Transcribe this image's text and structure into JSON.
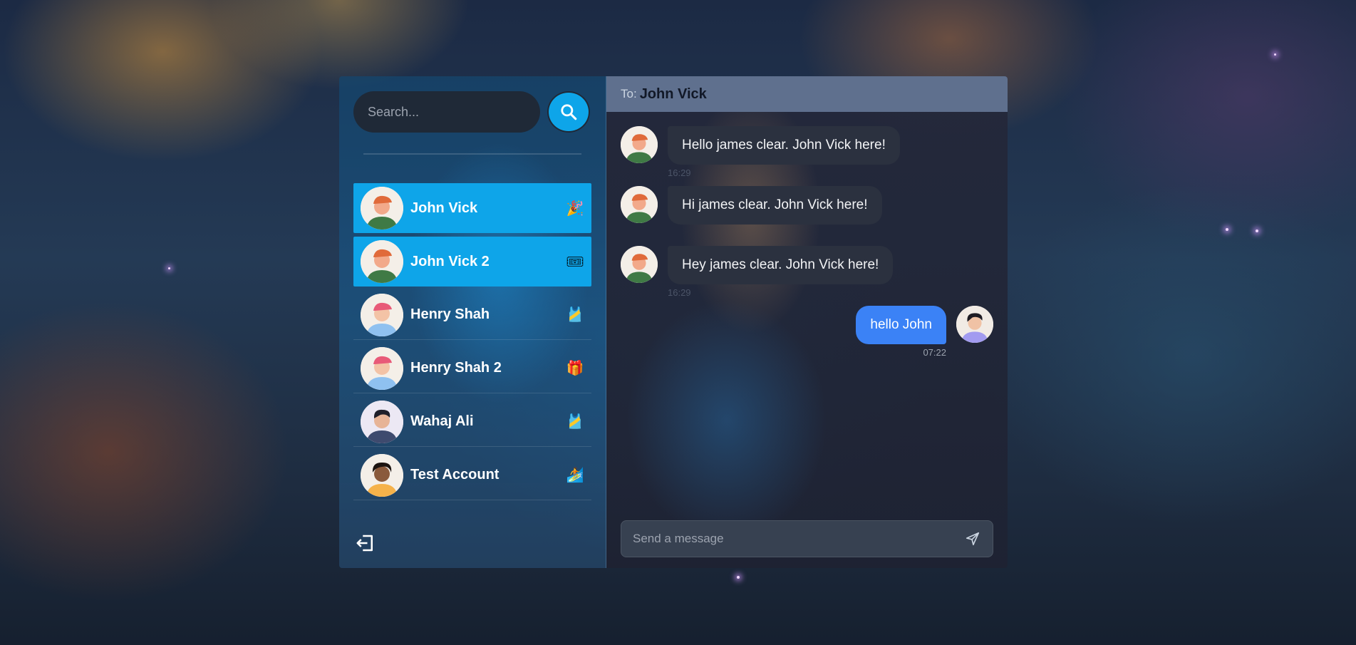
{
  "search": {
    "placeholder": "Search..."
  },
  "contacts": [
    {
      "name": "John Vick",
      "status_icon": "party-popper-icon",
      "status_glyph": "🎉",
      "active": true
    },
    {
      "name": "John Vick 2",
      "status_icon": "ticket-icon",
      "status_glyph": "🎟",
      "active": true
    },
    {
      "name": "Henry Shah",
      "status_icon": "sash-icon",
      "status_glyph": "🎽",
      "active": false
    },
    {
      "name": "Henry Shah 2",
      "status_icon": "gift-icon",
      "status_glyph": "🎁",
      "active": false
    },
    {
      "name": "Wahaj Ali",
      "status_icon": "sash-icon",
      "status_glyph": "🎽",
      "active": false
    },
    {
      "name": "Test Account",
      "status_icon": "surfer-icon",
      "status_glyph": "🏄",
      "active": false
    }
  ],
  "chat": {
    "to_label": "To:",
    "to_name": "John Vick",
    "messages": [
      {
        "text": "Hello james clear. John Vick here!",
        "time": "16:29",
        "mine": false
      },
      {
        "text": "Hi james clear. John Vick here!",
        "time": "",
        "mine": false
      },
      {
        "text": "Hey james clear. John Vick here!",
        "time": "16:29",
        "mine": false
      },
      {
        "text": "hello John",
        "time": "07:22",
        "mine": true
      }
    ],
    "composer_placeholder": "Send a message"
  },
  "colors": {
    "accent": "#0ea5e9",
    "my_bubble": "#3b82f6",
    "their_bubble": "#2b313f",
    "header": "#5f708e"
  }
}
